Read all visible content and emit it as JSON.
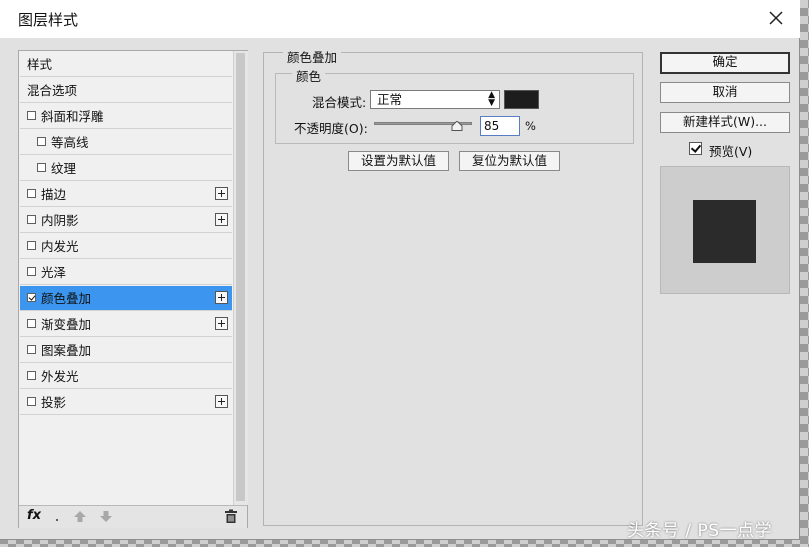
{
  "window": {
    "title": "图层样式"
  },
  "style_list": {
    "items": [
      {
        "label": "样式",
        "has_checkbox": false,
        "checked": false,
        "has_plus": false,
        "indent": false,
        "selected": false
      },
      {
        "label": "混合选项",
        "has_checkbox": false,
        "checked": false,
        "has_plus": false,
        "indent": false,
        "selected": false
      },
      {
        "label": "斜面和浮雕",
        "has_checkbox": true,
        "checked": false,
        "has_plus": false,
        "indent": false,
        "selected": false
      },
      {
        "label": "等高线",
        "has_checkbox": true,
        "checked": false,
        "has_plus": false,
        "indent": true,
        "selected": false
      },
      {
        "label": "纹理",
        "has_checkbox": true,
        "checked": false,
        "has_plus": false,
        "indent": true,
        "selected": false
      },
      {
        "label": "描边",
        "has_checkbox": true,
        "checked": false,
        "has_plus": true,
        "indent": false,
        "selected": false
      },
      {
        "label": "内阴影",
        "has_checkbox": true,
        "checked": false,
        "has_plus": true,
        "indent": false,
        "selected": false
      },
      {
        "label": "内发光",
        "has_checkbox": true,
        "checked": false,
        "has_plus": false,
        "indent": false,
        "selected": false
      },
      {
        "label": "光泽",
        "has_checkbox": true,
        "checked": false,
        "has_plus": false,
        "indent": false,
        "selected": false
      },
      {
        "label": "颜色叠加",
        "has_checkbox": true,
        "checked": true,
        "has_plus": true,
        "indent": false,
        "selected": true
      },
      {
        "label": "渐变叠加",
        "has_checkbox": true,
        "checked": false,
        "has_plus": true,
        "indent": false,
        "selected": false
      },
      {
        "label": "图案叠加",
        "has_checkbox": true,
        "checked": false,
        "has_plus": false,
        "indent": false,
        "selected": false
      },
      {
        "label": "外发光",
        "has_checkbox": true,
        "checked": false,
        "has_plus": false,
        "indent": false,
        "selected": false
      },
      {
        "label": "投影",
        "has_checkbox": true,
        "checked": false,
        "has_plus": true,
        "indent": false,
        "selected": false
      }
    ],
    "footer": {
      "fx_label": "fx"
    }
  },
  "color_overlay": {
    "section_title": "颜色叠加",
    "group_title": "颜色",
    "blend_mode_label": "混合模式:",
    "blend_mode_value": "正常",
    "overlay_color": "#1d1d1d",
    "opacity_label": "不透明度(O):",
    "opacity_value": "85",
    "opacity_fraction": 0.85,
    "opacity_unit": "%",
    "set_default_button": "设置为默认值",
    "reset_default_button": "复位为默认值"
  },
  "actions": {
    "ok": "确定",
    "cancel": "取消",
    "new_style": "新建样式(W)...",
    "preview_label": "预览(V)",
    "preview_checked": true
  },
  "colors": {
    "selected_row": "#3c96f0",
    "dialog_bg": "#e1e1e1"
  },
  "watermark": "头条号 / PS一点学"
}
